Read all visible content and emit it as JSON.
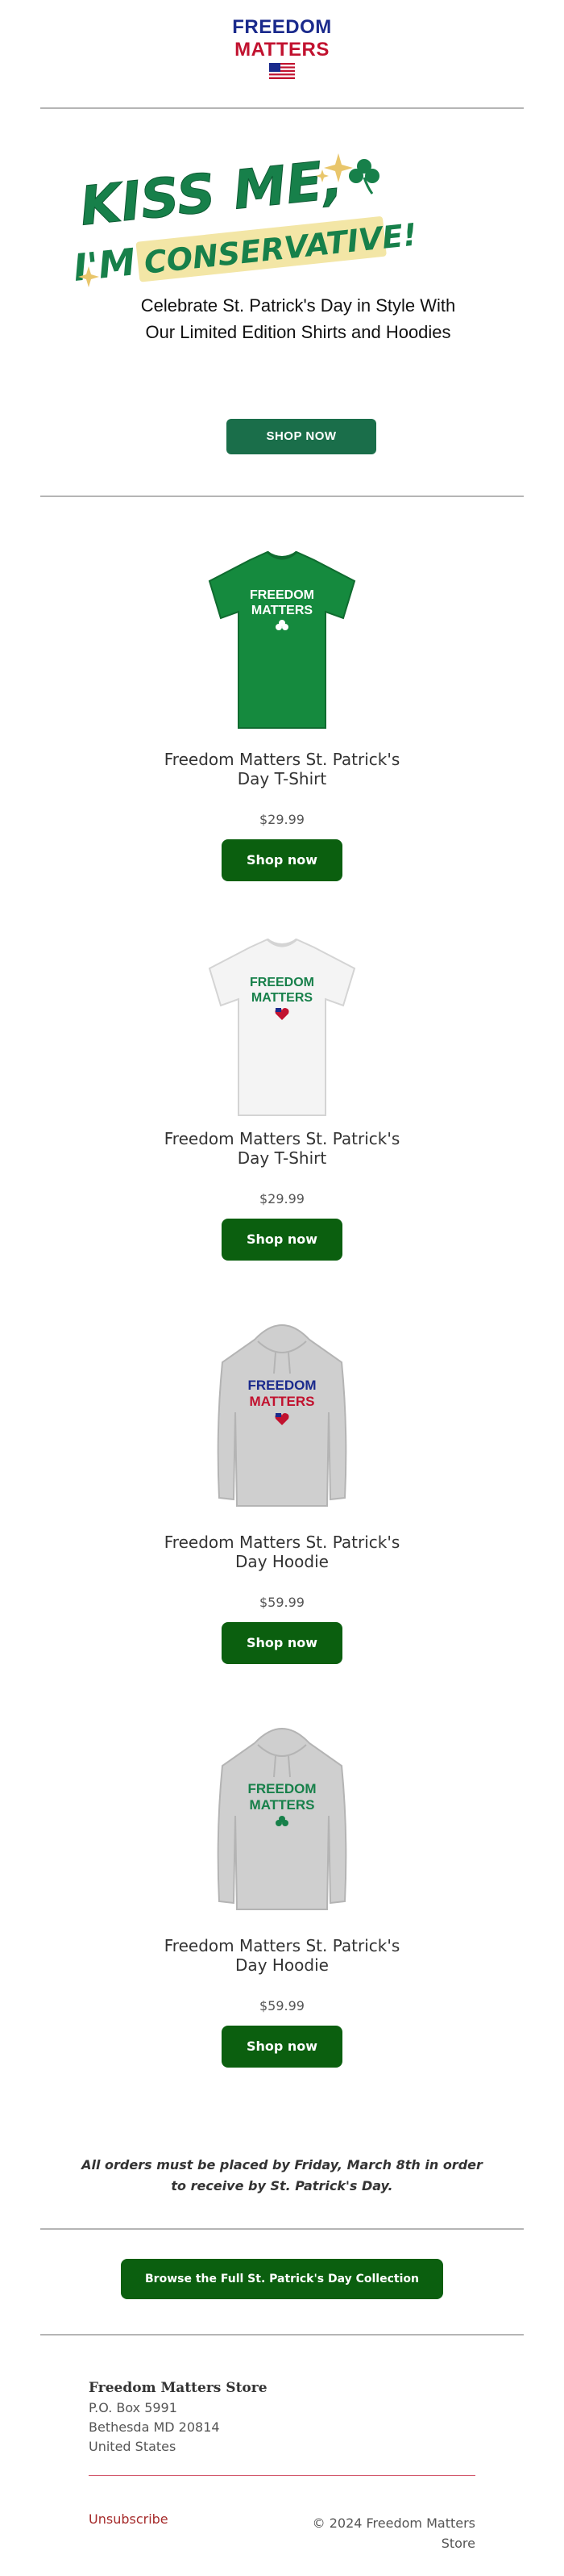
{
  "brand": {
    "line1": "FREEDOM",
    "line2": "MATTERS",
    "colors": {
      "blue": "#1a2a8c",
      "red": "#c1122f",
      "green": "#1a6e4a",
      "button_green": "#0b5f0f"
    }
  },
  "hero": {
    "headline_line1": "KISS ME,",
    "headline_line2a": "I'M",
    "headline_line2b": "CONSERVATIVE!",
    "subtitle": "Celebrate St. Patrick's Day in Style With Our Limited Edition Shirts and Hoodies",
    "cta": "SHOP NOW",
    "icons": [
      "shamrock-icon",
      "sparkle-icon"
    ]
  },
  "products": [
    {
      "title": "Freedom Matters St. Patrick's Day T-Shirt",
      "price": "$29.99",
      "cta": "Shop now",
      "garment": "t-shirt",
      "shirt_color": "#158a3e",
      "print_color": "#ffffff",
      "emblem": "shamrock"
    },
    {
      "title": "Freedom Matters St. Patrick's Day T-Shirt",
      "price": "$29.99",
      "cta": "Shop now",
      "garment": "t-shirt",
      "shirt_color": "#f4f4f4",
      "print_color": "#17804a",
      "emblem": "flag-heart"
    },
    {
      "title": "Freedom Matters St. Patrick's Day Hoodie",
      "price": "$59.99",
      "cta": "Shop now",
      "garment": "hoodie",
      "shirt_color": "#cfcfcf",
      "print_color": "#1a2a8c",
      "print_color2": "#c1122f",
      "emblem": "flag-heart"
    },
    {
      "title": "Freedom Matters St. Patrick's Day Hoodie",
      "price": "$59.99",
      "cta": "Shop now",
      "garment": "hoodie",
      "shirt_color": "#cfcfcf",
      "print_color": "#17804a",
      "emblem": "shamrock"
    }
  ],
  "product_print": {
    "line1": "FREEDOM",
    "line2": "MATTERS"
  },
  "deadline_note": "All orders must be placed by Friday, March 8th in order to receive by St. Patrick's Day.",
  "collection_cta": "Browse the Full St. Patrick's Day Collection",
  "footer": {
    "store_name": "Freedom Matters Store",
    "address": [
      "P.O. Box 5991",
      "Bethesda MD 20814",
      "United States"
    ],
    "unsubscribe": "Unsubscribe",
    "copyright": "© 2024 Freedom Matters Store"
  }
}
